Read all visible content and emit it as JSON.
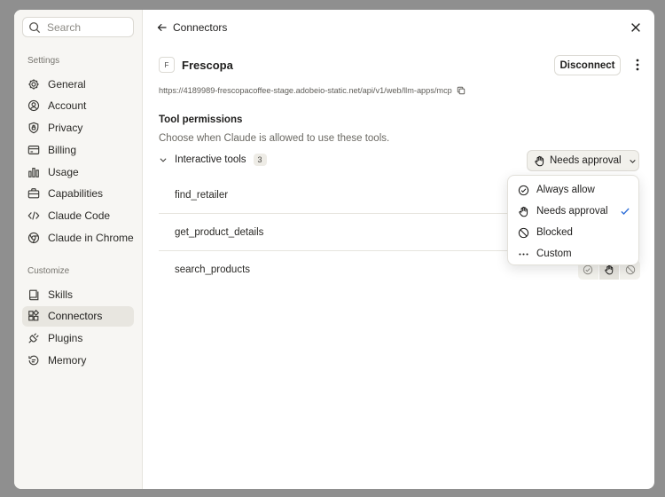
{
  "sidebar": {
    "search_placeholder": "Search",
    "settings_label": "Settings",
    "settings_items": [
      {
        "label": "General",
        "icon": "gear-icon"
      },
      {
        "label": "Account",
        "icon": "user-icon"
      },
      {
        "label": "Privacy",
        "icon": "shield-icon"
      },
      {
        "label": "Billing",
        "icon": "card-icon"
      },
      {
        "label": "Usage",
        "icon": "bar-chart-icon"
      },
      {
        "label": "Capabilities",
        "icon": "briefcase-icon"
      },
      {
        "label": "Claude Code",
        "icon": "code-icon"
      },
      {
        "label": "Claude in Chrome",
        "icon": "globe-icon"
      }
    ],
    "customize_label": "Customize",
    "customize_items": [
      {
        "label": "Skills",
        "icon": "book-icon"
      },
      {
        "label": "Connectors",
        "icon": "blocks-icon",
        "active": true
      },
      {
        "label": "Plugins",
        "icon": "plug-icon"
      },
      {
        "label": "Memory",
        "icon": "history-icon"
      }
    ]
  },
  "main": {
    "back_label": "Connectors",
    "connector": {
      "favicon_letter": "F",
      "name": "Frescopa",
      "disconnect_label": "Disconnect",
      "url": "https://4189989-frescopacoffee-stage.adobeio-static.net/api/v1/web/llm-apps/mcp"
    },
    "permissions": {
      "title": "Tool permissions",
      "description": "Choose when Claude is allowed to use these tools.",
      "group_label": "Interactive tools",
      "group_count": "3",
      "current_mode": "Needs approval",
      "tools": [
        "find_retailer",
        "get_product_details",
        "search_products"
      ]
    },
    "dropdown": {
      "options": [
        {
          "label": "Always allow",
          "icon": "check-circle-icon"
        },
        {
          "label": "Needs approval",
          "icon": "hand-icon",
          "selected": true
        },
        {
          "label": "Blocked",
          "icon": "blocked-icon"
        },
        {
          "label": "Custom",
          "icon": "ellipsis-icon"
        }
      ]
    }
  },
  "colors": {
    "accent_check": "#2f6fd8",
    "sidebar_bg": "#f7f6f3",
    "active_item_bg": "#e8e6e0"
  }
}
